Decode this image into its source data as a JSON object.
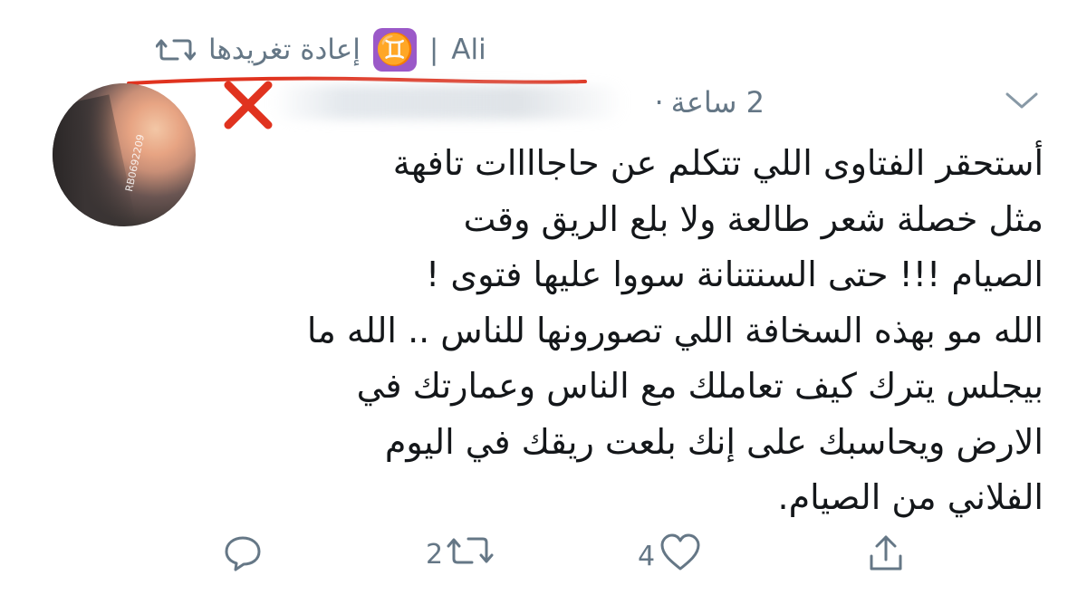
{
  "retweet_header": {
    "icon": "retweet-icon",
    "text": "إعادة تغريدها",
    "zodiac": "♊",
    "separator": "|",
    "name": "Ali"
  },
  "tweet": {
    "time": "2 ساعة",
    "dot": "·",
    "body": "أستحقر الفتاوى اللي تتكلم عن حاجاااات تافهة\nمثل خصلة شعر طالعة ولا بلع الريق وقت\nالصيام !!! حتى السنتنانة سووا عليها فتوى !\nالله مو بهذه السخافة اللي تصورونها للناس .. الله ما\nبيجلس يترك كيف تعاملك مع الناس وعمارتك في\nالارض ويحاسبك على إنك بلعت ريقك في اليوم\nالفلاني من الصيام.",
    "avatar_watermark": "RB0692209"
  },
  "actions": {
    "reply": {
      "icon": "reply-icon",
      "count": ""
    },
    "retweet": {
      "icon": "retweet-icon",
      "count": "2"
    },
    "like": {
      "icon": "heart-icon",
      "count": "4"
    },
    "share": {
      "icon": "share-icon",
      "count": ""
    }
  },
  "colors": {
    "muted": "#657786",
    "text": "#14171a",
    "annotation_red": "#e0331f",
    "zodiac_purple": "#9b59c8"
  }
}
